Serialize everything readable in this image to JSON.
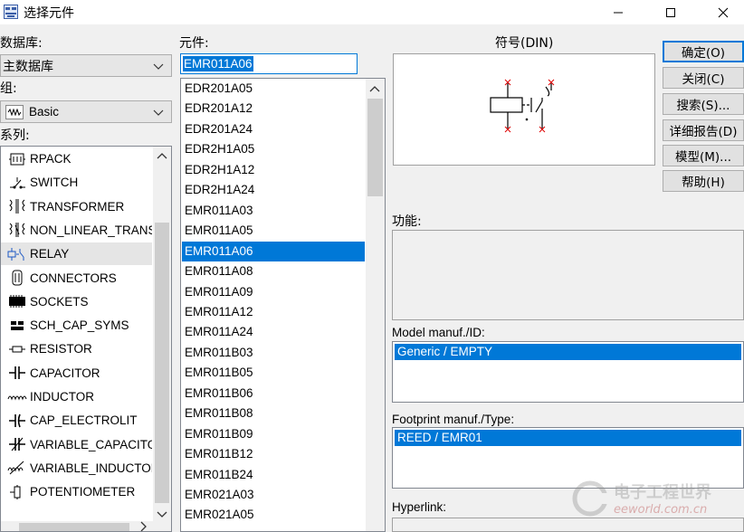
{
  "window": {
    "title": "选择元件"
  },
  "database": {
    "label": "数据库:",
    "value": "主数据库"
  },
  "group": {
    "label": "组:",
    "value": "Basic"
  },
  "family": {
    "label": "系列:",
    "items": [
      {
        "label": "RPACK",
        "icon": "rpack-icon"
      },
      {
        "label": "SWITCH",
        "icon": "switch-icon"
      },
      {
        "label": "TRANSFORMER",
        "icon": "transformer-icon"
      },
      {
        "label": "NON_LINEAR_TRANSFORMER",
        "icon": "nonlinear-transformer-icon"
      },
      {
        "label": "RELAY",
        "icon": "relay-icon"
      },
      {
        "label": "CONNECTORS",
        "icon": "connectors-icon"
      },
      {
        "label": "SOCKETS",
        "icon": "sockets-icon"
      },
      {
        "label": "SCH_CAP_SYMS",
        "icon": "sch-cap-syms-icon"
      },
      {
        "label": "RESISTOR",
        "icon": "resistor-icon"
      },
      {
        "label": "CAPACITOR",
        "icon": "capacitor-icon"
      },
      {
        "label": "INDUCTOR",
        "icon": "inductor-icon"
      },
      {
        "label": "CAP_ELECTROLIT",
        "icon": "cap-electrolit-icon"
      },
      {
        "label": "VARIABLE_CAPACITOR",
        "icon": "variable-capacitor-icon"
      },
      {
        "label": "VARIABLE_INDUCTOR",
        "icon": "variable-inductor-icon"
      },
      {
        "label": "POTENTIOMETER",
        "icon": "potentiometer-icon"
      }
    ],
    "selected": "RELAY"
  },
  "component": {
    "label": "元件:",
    "value": "EMR011A06",
    "items": [
      "EDR201A05",
      "EDR201A12",
      "EDR201A24",
      "EDR2H1A05",
      "EDR2H1A12",
      "EDR2H1A24",
      "EMR011A03",
      "EMR011A05",
      "EMR011A06",
      "EMR011A08",
      "EMR011A09",
      "EMR011A12",
      "EMR011A24",
      "EMR011B03",
      "EMR011B05",
      "EMR011B06",
      "EMR011B08",
      "EMR011B09",
      "EMR011B12",
      "EMR011B24",
      "EMR021A03",
      "EMR021A05"
    ],
    "selected": "EMR011A06"
  },
  "symbol": {
    "label": "符号(DIN)"
  },
  "function": {
    "label": "功能:"
  },
  "model": {
    "label": "Model manuf./ID:",
    "value": "Generic / EMPTY"
  },
  "footprint": {
    "label": "Footprint manuf./Type:",
    "value": "REED / EMR01"
  },
  "hyperlink": {
    "label": "Hyperlink:"
  },
  "buttons": {
    "ok": "确定(O)",
    "close": "关闭(C)",
    "search": "搜索(S)...",
    "detail": "详细报告(D)",
    "model": "模型(M)...",
    "help": "帮助(H)"
  },
  "watermark": {
    "text": "电子工程世界",
    "url": "eeworld.com.cn"
  },
  "colors": {
    "selection": "#0078d7",
    "relay_pin": "#e00000"
  }
}
